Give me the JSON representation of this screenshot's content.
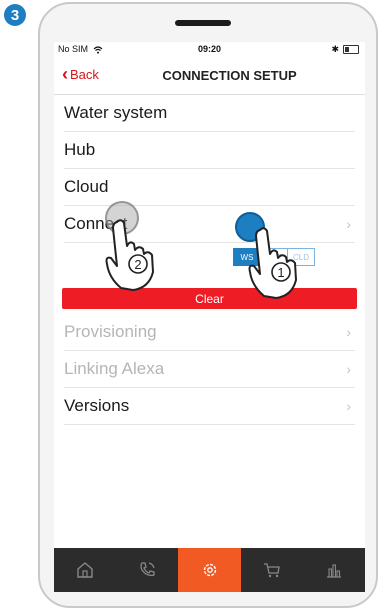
{
  "step_number": "3",
  "status_bar": {
    "carrier": "No SIM",
    "time": "09:20",
    "bluetooth": "✱"
  },
  "nav": {
    "back_label": "Back",
    "title": "CONNECTION SETUP"
  },
  "menu": {
    "water_system": "Water system",
    "hub": "Hub",
    "cloud": "Cloud",
    "connect": "Connect",
    "provisioning": "Provisioning",
    "linking_alexa": "Linking Alexa",
    "versions": "Versions"
  },
  "segment": {
    "options": [
      "WS",
      "HUB",
      "CLD"
    ],
    "selected": "WS"
  },
  "clear_button": "Clear",
  "gesture_steps": [
    "2",
    "1"
  ],
  "tabs": [
    {
      "icon": "home-icon",
      "active": false
    },
    {
      "icon": "phone-icon",
      "active": false
    },
    {
      "icon": "settings-gear-icon",
      "active": true
    },
    {
      "icon": "cart-icon",
      "active": false
    },
    {
      "icon": "bar-chart-icon",
      "active": false
    }
  ],
  "colors": {
    "accent_red": "#ee1c25",
    "active_tab": "#f15a22",
    "tab_bar": "#2c2c2c",
    "segment_blue": "#1d7ec2",
    "badge_blue": "#1d7ec2"
  }
}
